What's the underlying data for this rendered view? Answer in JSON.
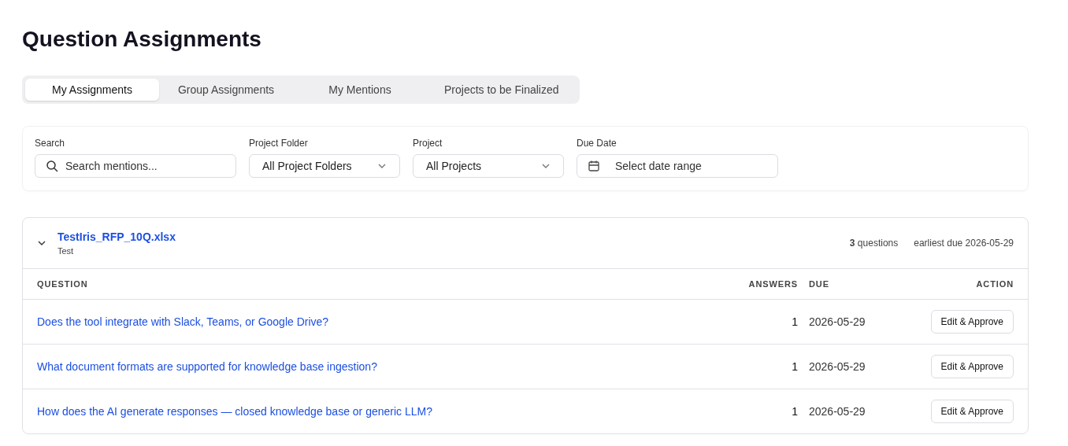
{
  "title": "Question Assignments",
  "tabs": [
    {
      "label": "My Assignments",
      "selected": true
    },
    {
      "label": "Group Assignments",
      "selected": false
    },
    {
      "label": "My Mentions",
      "selected": false
    },
    {
      "label": "Projects to be Finalized",
      "selected": false
    }
  ],
  "filters": [
    {
      "kind": "search",
      "label": "Search",
      "placeholder": "Search mentions..."
    },
    {
      "kind": "select",
      "label": "Project Folder",
      "value": "All Project Folders"
    },
    {
      "kind": "select",
      "label": "Project",
      "value": "All Projects"
    },
    {
      "kind": "date",
      "label": "Due Date",
      "placeholder": "Select date range"
    }
  ],
  "group": {
    "expanded": true,
    "file": "TestIris_RFP_10Q.xlsx",
    "subtitle": "Test",
    "count": "**3** questions",
    "earliest_due": "earliest due 2026-05-29",
    "table": {
      "columns": [
        "QUESTION",
        "ANSWERS",
        "DUE",
        "ACTION"
      ],
      "rows": [
        {
          "question": "Does the tool integrate with Slack, Teams, or Google Drive?",
          "answers": "1",
          "due": "2026-05-29",
          "action": "Edit & Approve"
        },
        {
          "question": "What document formats are supported for knowledge base ingestion?",
          "answers": "1",
          "due": "2026-05-29",
          "action": "Edit & Approve"
        },
        {
          "question": "How does the AI generate responses — closed knowledge base or generic LLM?",
          "answers": "1",
          "due": "2026-05-29",
          "action": "Edit & Approve"
        }
      ]
    }
  }
}
